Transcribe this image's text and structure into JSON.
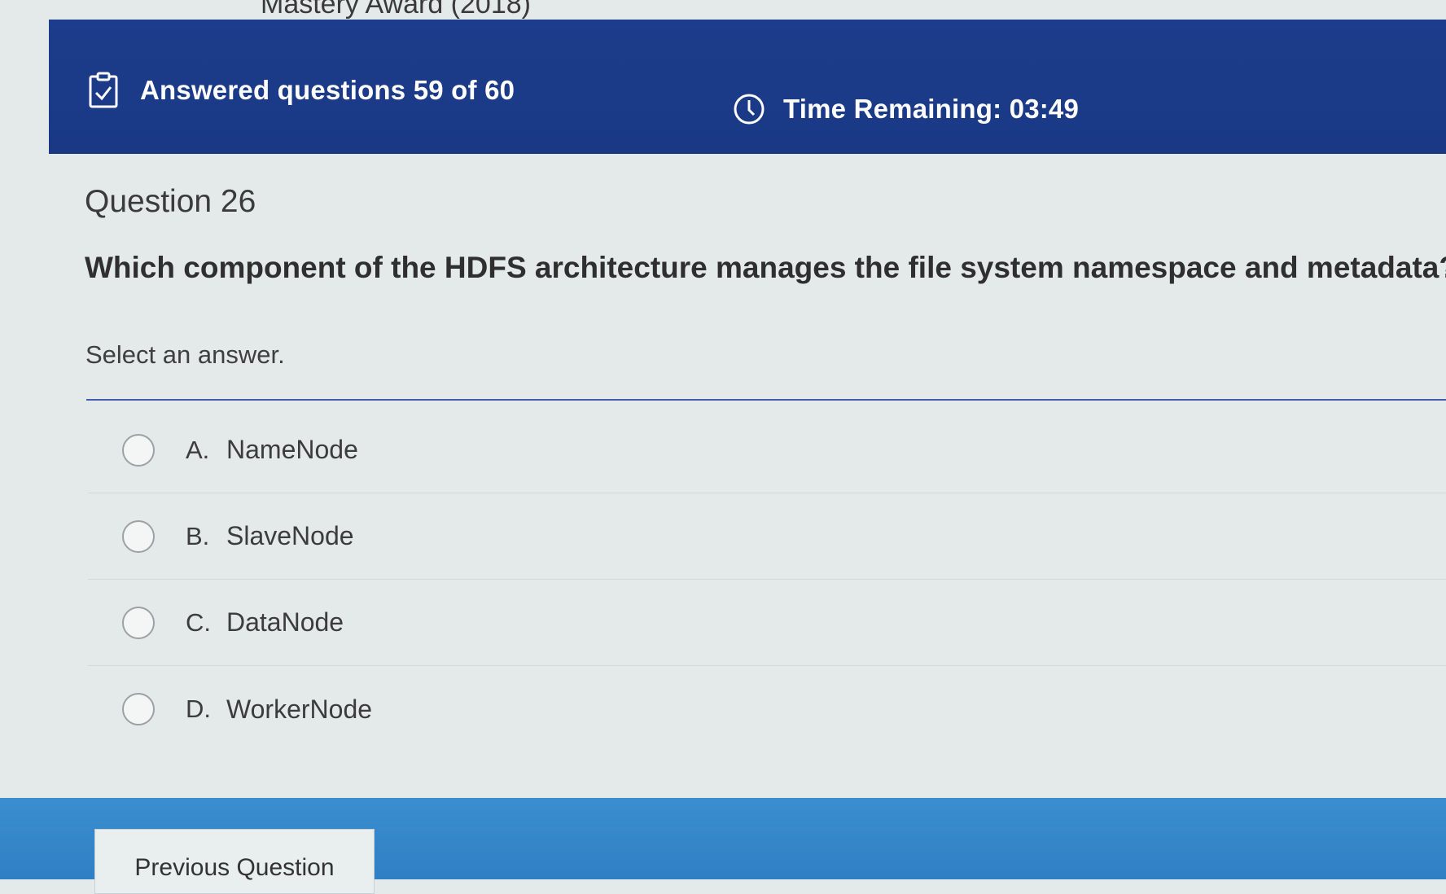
{
  "page_title": "Mastery Award (2018)",
  "header": {
    "progress_text": "Answered questions 59 of 60",
    "timer_text": "Time Remaining: 03:49",
    "background_color": "#1c3d8c",
    "progress_icon": "clipboard-check-icon",
    "timer_icon": "clock-icon"
  },
  "question": {
    "number_label": "Question 26",
    "text": "Which component of the HDFS architecture manages the file system namespace and metadata?",
    "instruction": "Select an answer."
  },
  "options": [
    {
      "letter": "A.",
      "text": "NameNode"
    },
    {
      "letter": "B.",
      "text": "SlaveNode"
    },
    {
      "letter": "C.",
      "text": "DataNode"
    },
    {
      "letter": "D.",
      "text": "WorkerNode"
    }
  ],
  "footer": {
    "previous_button_label": "Previous Question",
    "background_color": "#3a8fd0"
  }
}
